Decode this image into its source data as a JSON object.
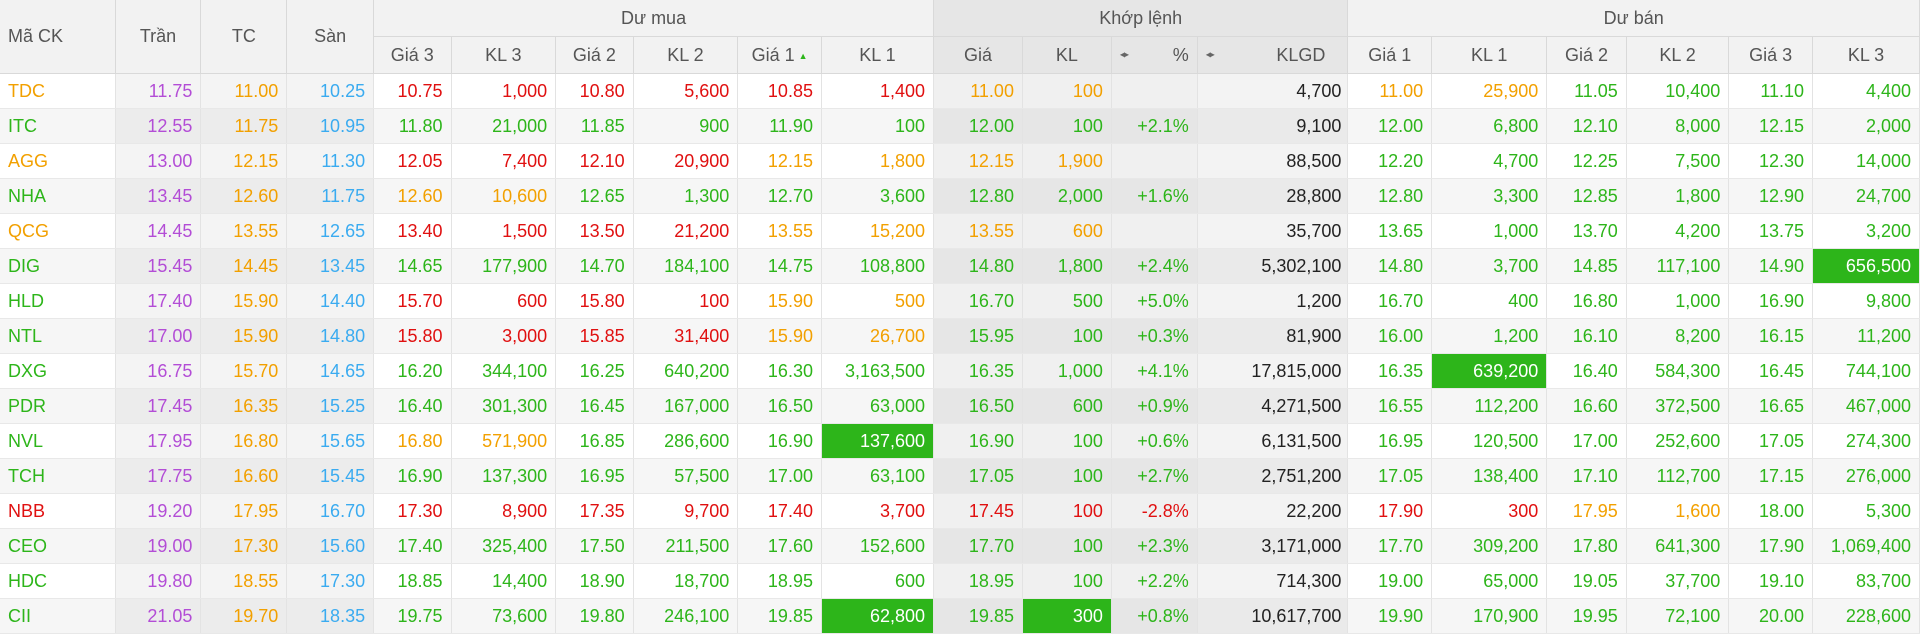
{
  "headers": {
    "symbol": "Mã CK",
    "ceiling": "Trần",
    "reference": "TC",
    "floor": "Sàn",
    "bid_group": "Dư mua",
    "match_group": "Khớp lệnh",
    "ask_group": "Dư bán",
    "bid_cols": [
      "Giá 3",
      "KL 3",
      "Giá 2",
      "KL 2",
      "Giá 1",
      "KL 1"
    ],
    "match_cols": [
      "Giá",
      "KL",
      "%",
      "KLGD"
    ],
    "ask_cols": [
      "Giá 1",
      "KL 1",
      "Giá 2",
      "KL 2",
      "Giá 3",
      "KL 3"
    ]
  },
  "colors": {
    "up": "#2db51a",
    "down": "#e01010",
    "reference": "#f2a000",
    "ceiling": "#b34dd6",
    "floor": "#3aabf0",
    "highlight": "#2db51a"
  },
  "icons": {
    "sort": "sort-asc-icon",
    "swap": "swap-columns-icon"
  },
  "rows": [
    {
      "sym": "TDC",
      "sc": "r",
      "ceil": "11.75",
      "ref": "11.00",
      "floor": "10.25",
      "b3p": "10.75",
      "b3pc": "d",
      "b3v": "1,000",
      "b3vc": "d",
      "b2p": "10.80",
      "b2pc": "d",
      "b2v": "5,600",
      "b2vc": "d",
      "b1p": "10.85",
      "b1pc": "d",
      "b1v": "1,400",
      "b1vc": "d",
      "mp": "11.00",
      "mpc": "r",
      "mv": "100",
      "mvc": "r",
      "pct": "",
      "pctc": "r",
      "klgd": "4,700",
      "a1p": "11.00",
      "a1pc": "r",
      "a1v": "25,900",
      "a1vc": "r",
      "a2p": "11.05",
      "a2pc": "u",
      "a2v": "10,400",
      "a2vc": "u",
      "a3p": "11.10",
      "a3pc": "u",
      "a3v": "4,400",
      "a3vc": "u"
    },
    {
      "sym": "ITC",
      "sc": "u",
      "ceil": "12.55",
      "ref": "11.75",
      "floor": "10.95",
      "b3p": "11.80",
      "b3pc": "u",
      "b3v": "21,000",
      "b3vc": "u",
      "b2p": "11.85",
      "b2pc": "u",
      "b2v": "900",
      "b2vc": "u",
      "b1p": "11.90",
      "b1pc": "u",
      "b1v": "100",
      "b1vc": "u",
      "mp": "12.00",
      "mpc": "u",
      "mv": "100",
      "mvc": "u",
      "pct": "+2.1%",
      "pctc": "u",
      "klgd": "9,100",
      "a1p": "12.00",
      "a1pc": "u",
      "a1v": "6,800",
      "a1vc": "u",
      "a2p": "12.10",
      "a2pc": "u",
      "a2v": "8,000",
      "a2vc": "u",
      "a3p": "12.15",
      "a3pc": "u",
      "a3v": "2,000",
      "a3vc": "u"
    },
    {
      "sym": "AGG",
      "sc": "r",
      "ceil": "13.00",
      "ref": "12.15",
      "floor": "11.30",
      "b3p": "12.05",
      "b3pc": "d",
      "b3v": "7,400",
      "b3vc": "d",
      "b2p": "12.10",
      "b2pc": "d",
      "b2v": "20,900",
      "b2vc": "d",
      "b1p": "12.15",
      "b1pc": "r",
      "b1v": "1,800",
      "b1vc": "r",
      "mp": "12.15",
      "mpc": "r",
      "mv": "1,900",
      "mvc": "r",
      "pct": "",
      "pctc": "r",
      "klgd": "88,500",
      "a1p": "12.20",
      "a1pc": "u",
      "a1v": "4,700",
      "a1vc": "u",
      "a2p": "12.25",
      "a2pc": "u",
      "a2v": "7,500",
      "a2vc": "u",
      "a3p": "12.30",
      "a3pc": "u",
      "a3v": "14,000",
      "a3vc": "u"
    },
    {
      "sym": "NHA",
      "sc": "u",
      "ceil": "13.45",
      "ref": "12.60",
      "floor": "11.75",
      "b3p": "12.60",
      "b3pc": "r",
      "b3v": "10,600",
      "b3vc": "r",
      "b2p": "12.65",
      "b2pc": "u",
      "b2v": "1,300",
      "b2vc": "u",
      "b1p": "12.70",
      "b1pc": "u",
      "b1v": "3,600",
      "b1vc": "u",
      "mp": "12.80",
      "mpc": "u",
      "mv": "2,000",
      "mvc": "u",
      "pct": "+1.6%",
      "pctc": "u",
      "klgd": "28,800",
      "a1p": "12.80",
      "a1pc": "u",
      "a1v": "3,300",
      "a1vc": "u",
      "a2p": "12.85",
      "a2pc": "u",
      "a2v": "1,800",
      "a2vc": "u",
      "a3p": "12.90",
      "a3pc": "u",
      "a3v": "24,700",
      "a3vc": "u"
    },
    {
      "sym": "QCG",
      "sc": "r",
      "ceil": "14.45",
      "ref": "13.55",
      "floor": "12.65",
      "b3p": "13.40",
      "b3pc": "d",
      "b3v": "1,500",
      "b3vc": "d",
      "b2p": "13.50",
      "b2pc": "d",
      "b2v": "21,200",
      "b2vc": "d",
      "b1p": "13.55",
      "b1pc": "r",
      "b1v": "15,200",
      "b1vc": "r",
      "mp": "13.55",
      "mpc": "r",
      "mv": "600",
      "mvc": "r",
      "pct": "",
      "pctc": "r",
      "klgd": "35,700",
      "a1p": "13.65",
      "a1pc": "u",
      "a1v": "1,000",
      "a1vc": "u",
      "a2p": "13.70",
      "a2pc": "u",
      "a2v": "4,200",
      "a2vc": "u",
      "a3p": "13.75",
      "a3pc": "u",
      "a3v": "3,200",
      "a3vc": "u"
    },
    {
      "sym": "DIG",
      "sc": "u",
      "ceil": "15.45",
      "ref": "14.45",
      "floor": "13.45",
      "b3p": "14.65",
      "b3pc": "u",
      "b3v": "177,900",
      "b3vc": "u",
      "b2p": "14.70",
      "b2pc": "u",
      "b2v": "184,100",
      "b2vc": "u",
      "b1p": "14.75",
      "b1pc": "u",
      "b1v": "108,800",
      "b1vc": "u",
      "mp": "14.80",
      "mpc": "u",
      "mv": "1,800",
      "mvc": "u",
      "pct": "+2.4%",
      "pctc": "u",
      "klgd": "5,302,100",
      "a1p": "14.80",
      "a1pc": "u",
      "a1v": "3,700",
      "a1vc": "u",
      "a2p": "14.85",
      "a2pc": "u",
      "a2v": "117,100",
      "a2vc": "u",
      "a3p": "14.90",
      "a3pc": "u",
      "a3v": "656,500",
      "a3vc": "u",
      "hl": "a3v"
    },
    {
      "sym": "HLD",
      "sc": "u",
      "ceil": "17.40",
      "ref": "15.90",
      "floor": "14.40",
      "b3p": "15.70",
      "b3pc": "d",
      "b3v": "600",
      "b3vc": "d",
      "b2p": "15.80",
      "b2pc": "d",
      "b2v": "100",
      "b2vc": "d",
      "b1p": "15.90",
      "b1pc": "r",
      "b1v": "500",
      "b1vc": "r",
      "mp": "16.70",
      "mpc": "u",
      "mv": "500",
      "mvc": "u",
      "pct": "+5.0%",
      "pctc": "u",
      "klgd": "1,200",
      "a1p": "16.70",
      "a1pc": "u",
      "a1v": "400",
      "a1vc": "u",
      "a2p": "16.80",
      "a2pc": "u",
      "a2v": "1,000",
      "a2vc": "u",
      "a3p": "16.90",
      "a3pc": "u",
      "a3v": "9,800",
      "a3vc": "u"
    },
    {
      "sym": "NTL",
      "sc": "u",
      "ceil": "17.00",
      "ref": "15.90",
      "floor": "14.80",
      "b3p": "15.80",
      "b3pc": "d",
      "b3v": "3,000",
      "b3vc": "d",
      "b2p": "15.85",
      "b2pc": "d",
      "b2v": "31,400",
      "b2vc": "d",
      "b1p": "15.90",
      "b1pc": "r",
      "b1v": "26,700",
      "b1vc": "r",
      "mp": "15.95",
      "mpc": "u",
      "mv": "100",
      "mvc": "u",
      "pct": "+0.3%",
      "pctc": "u",
      "klgd": "81,900",
      "a1p": "16.00",
      "a1pc": "u",
      "a1v": "1,200",
      "a1vc": "u",
      "a2p": "16.10",
      "a2pc": "u",
      "a2v": "8,200",
      "a2vc": "u",
      "a3p": "16.15",
      "a3pc": "u",
      "a3v": "11,200",
      "a3vc": "u"
    },
    {
      "sym": "DXG",
      "sc": "u",
      "ceil": "16.75",
      "ref": "15.70",
      "floor": "14.65",
      "b3p": "16.20",
      "b3pc": "u",
      "b3v": "344,100",
      "b3vc": "u",
      "b2p": "16.25",
      "b2pc": "u",
      "b2v": "640,200",
      "b2vc": "u",
      "b1p": "16.30",
      "b1pc": "u",
      "b1v": "3,163,500",
      "b1vc": "u",
      "mp": "16.35",
      "mpc": "u",
      "mv": "1,000",
      "mvc": "u",
      "pct": "+4.1%",
      "pctc": "u",
      "klgd": "17,815,000",
      "a1p": "16.35",
      "a1pc": "u",
      "a1v": "639,200",
      "a1vc": "u",
      "a2p": "16.40",
      "a2pc": "u",
      "a2v": "584,300",
      "a2vc": "u",
      "a3p": "16.45",
      "a3pc": "u",
      "a3v": "744,100",
      "a3vc": "u",
      "hl": "a1v"
    },
    {
      "sym": "PDR",
      "sc": "u",
      "ceil": "17.45",
      "ref": "16.35",
      "floor": "15.25",
      "b3p": "16.40",
      "b3pc": "u",
      "b3v": "301,300",
      "b3vc": "u",
      "b2p": "16.45",
      "b2pc": "u",
      "b2v": "167,000",
      "b2vc": "u",
      "b1p": "16.50",
      "b1pc": "u",
      "b1v": "63,000",
      "b1vc": "u",
      "mp": "16.50",
      "mpc": "u",
      "mv": "600",
      "mvc": "u",
      "pct": "+0.9%",
      "pctc": "u",
      "klgd": "4,271,500",
      "a1p": "16.55",
      "a1pc": "u",
      "a1v": "112,200",
      "a1vc": "u",
      "a2p": "16.60",
      "a2pc": "u",
      "a2v": "372,500",
      "a2vc": "u",
      "a3p": "16.65",
      "a3pc": "u",
      "a3v": "467,000",
      "a3vc": "u"
    },
    {
      "sym": "NVL",
      "sc": "u",
      "ceil": "17.95",
      "ref": "16.80",
      "floor": "15.65",
      "b3p": "16.80",
      "b3pc": "r",
      "b3v": "571,900",
      "b3vc": "r",
      "b2p": "16.85",
      "b2pc": "u",
      "b2v": "286,600",
      "b2vc": "u",
      "b1p": "16.90",
      "b1pc": "u",
      "b1v": "137,600",
      "b1vc": "u",
      "mp": "16.90",
      "mpc": "u",
      "mv": "100",
      "mvc": "u",
      "pct": "+0.6%",
      "pctc": "u",
      "klgd": "6,131,500",
      "a1p": "16.95",
      "a1pc": "u",
      "a1v": "120,500",
      "a1vc": "u",
      "a2p": "17.00",
      "a2pc": "u",
      "a2v": "252,600",
      "a2vc": "u",
      "a3p": "17.05",
      "a3pc": "u",
      "a3v": "274,300",
      "a3vc": "u",
      "hl": "b1v"
    },
    {
      "sym": "TCH",
      "sc": "u",
      "ceil": "17.75",
      "ref": "16.60",
      "floor": "15.45",
      "b3p": "16.90",
      "b3pc": "u",
      "b3v": "137,300",
      "b3vc": "u",
      "b2p": "16.95",
      "b2pc": "u",
      "b2v": "57,500",
      "b2vc": "u",
      "b1p": "17.00",
      "b1pc": "u",
      "b1v": "63,100",
      "b1vc": "u",
      "mp": "17.05",
      "mpc": "u",
      "mv": "100",
      "mvc": "u",
      "pct": "+2.7%",
      "pctc": "u",
      "klgd": "2,751,200",
      "a1p": "17.05",
      "a1pc": "u",
      "a1v": "138,400",
      "a1vc": "u",
      "a2p": "17.10",
      "a2pc": "u",
      "a2v": "112,700",
      "a2vc": "u",
      "a3p": "17.15",
      "a3pc": "u",
      "a3v": "276,000",
      "a3vc": "u"
    },
    {
      "sym": "NBB",
      "sc": "d",
      "ceil": "19.20",
      "ref": "17.95",
      "floor": "16.70",
      "b3p": "17.30",
      "b3pc": "d",
      "b3v": "8,900",
      "b3vc": "d",
      "b2p": "17.35",
      "b2pc": "d",
      "b2v": "9,700",
      "b2vc": "d",
      "b1p": "17.40",
      "b1pc": "d",
      "b1v": "3,700",
      "b1vc": "d",
      "mp": "17.45",
      "mpc": "d",
      "mv": "100",
      "mvc": "d",
      "pct": "-2.8%",
      "pctc": "d",
      "klgd": "22,200",
      "a1p": "17.90",
      "a1pc": "d",
      "a1v": "300",
      "a1vc": "d",
      "a2p": "17.95",
      "a2pc": "r",
      "a2v": "1,600",
      "a2vc": "r",
      "a3p": "18.00",
      "a3pc": "u",
      "a3v": "5,300",
      "a3vc": "u"
    },
    {
      "sym": "CEO",
      "sc": "u",
      "ceil": "19.00",
      "ref": "17.30",
      "floor": "15.60",
      "b3p": "17.40",
      "b3pc": "u",
      "b3v": "325,400",
      "b3vc": "u",
      "b2p": "17.50",
      "b2pc": "u",
      "b2v": "211,500",
      "b2vc": "u",
      "b1p": "17.60",
      "b1pc": "u",
      "b1v": "152,600",
      "b1vc": "u",
      "mp": "17.70",
      "mpc": "u",
      "mv": "100",
      "mvc": "u",
      "pct": "+2.3%",
      "pctc": "u",
      "klgd": "3,171,000",
      "a1p": "17.70",
      "a1pc": "u",
      "a1v": "309,200",
      "a1vc": "u",
      "a2p": "17.80",
      "a2pc": "u",
      "a2v": "641,300",
      "a2vc": "u",
      "a3p": "17.90",
      "a3pc": "u",
      "a3v": "1,069,400",
      "a3vc": "u"
    },
    {
      "sym": "HDC",
      "sc": "u",
      "ceil": "19.80",
      "ref": "18.55",
      "floor": "17.30",
      "b3p": "18.85",
      "b3pc": "u",
      "b3v": "14,400",
      "b3vc": "u",
      "b2p": "18.90",
      "b2pc": "u",
      "b2v": "18,700",
      "b2vc": "u",
      "b1p": "18.95",
      "b1pc": "u",
      "b1v": "600",
      "b1vc": "u",
      "mp": "18.95",
      "mpc": "u",
      "mv": "100",
      "mvc": "u",
      "pct": "+2.2%",
      "pctc": "u",
      "klgd": "714,300",
      "a1p": "19.00",
      "a1pc": "u",
      "a1v": "65,000",
      "a1vc": "u",
      "a2p": "19.05",
      "a2pc": "u",
      "a2v": "37,700",
      "a2vc": "u",
      "a3p": "19.10",
      "a3pc": "u",
      "a3v": "83,700",
      "a3vc": "u"
    },
    {
      "sym": "CII",
      "sc": "u",
      "ceil": "21.05",
      "ref": "19.70",
      "floor": "18.35",
      "b3p": "19.75",
      "b3pc": "u",
      "b3v": "73,600",
      "b3vc": "u",
      "b2p": "19.80",
      "b2pc": "u",
      "b2v": "246,100",
      "b2vc": "u",
      "b1p": "19.85",
      "b1pc": "u",
      "b1v": "62,800",
      "b1vc": "u",
      "mp": "19.85",
      "mpc": "u",
      "mv": "300",
      "mvc": "u",
      "pct": "+0.8%",
      "pctc": "u",
      "klgd": "10,617,700",
      "a1p": "19.90",
      "a1pc": "u",
      "a1v": "170,900",
      "a1vc": "u",
      "a2p": "19.95",
      "a2pc": "u",
      "a2v": "72,100",
      "a2vc": "u",
      "a3p": "20.00",
      "a3pc": "u",
      "a3v": "228,600",
      "a3vc": "u",
      "hl": "b1v,mv"
    }
  ]
}
